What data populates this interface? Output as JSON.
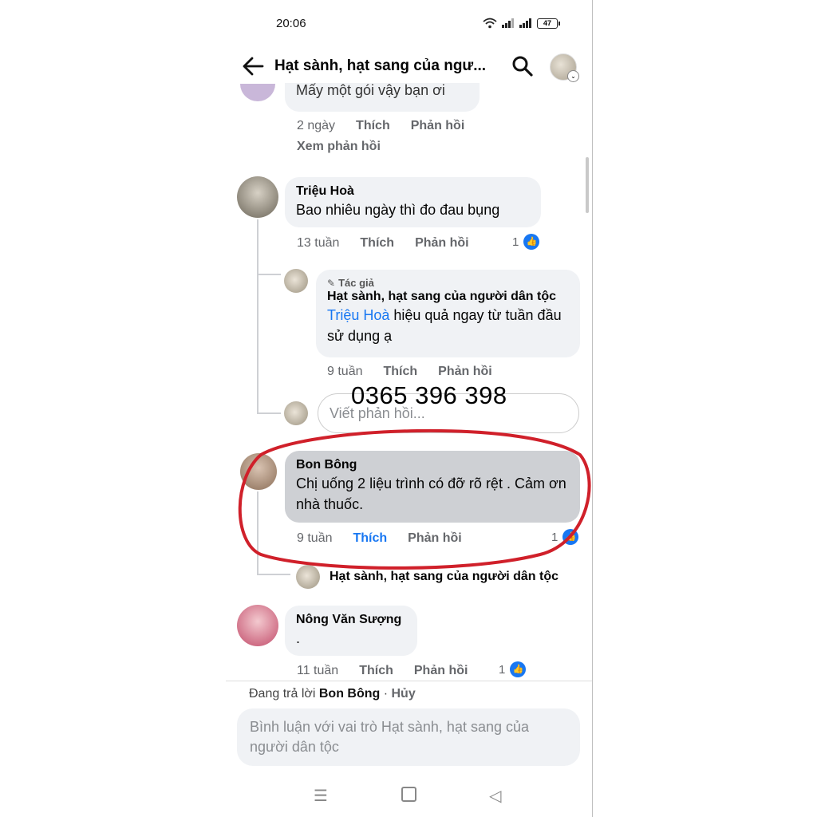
{
  "status": {
    "time": "20:06",
    "battery": "47"
  },
  "header": {
    "title": "Hạt sành, hạt sang của ngư...",
    "back_icon": "back-arrow-icon",
    "search_icon": "search-icon"
  },
  "comments": {
    "c0": {
      "text_partial": "Mấy một gói vậy bạn ơi",
      "time": "2 ngày",
      "like": "Thích",
      "reply": "Phản hồi",
      "view_replies": "Xem phản hồi"
    },
    "c1": {
      "name": "Triệu Hoà",
      "text": "Bao nhiêu ngày thì đo đau bụng",
      "time": "13 tuần",
      "like": "Thích",
      "reply": "Phản hồi",
      "reactions": "1"
    },
    "r1": {
      "badge": "Tác giả",
      "name": "Hạt sành, hạt sang của người dân tộc",
      "mention": "Triệu Hoà",
      "text": " hiệu quả ngay từ tuần đầu sử dụng ạ",
      "time": "9 tuần",
      "like": "Thích",
      "reply": "Phản hồi"
    },
    "reply_placeholder": "Viết phản hồi...",
    "c2": {
      "name": "Bon Bông",
      "text": "Chị uống 2 liệu trình có đỡ rõ rệt . Cảm ơn nhà thuốc.",
      "time": "9 tuần",
      "like": "Thích",
      "reply": "Phản hồi",
      "reactions": "1"
    },
    "c2_reply_author": "Hạt sành, hạt sang của người dân tộc",
    "c3": {
      "name": "Nông Văn Sượng",
      "text": ".",
      "time": "11 tuần",
      "like": "Thích",
      "reply": "Phản hồi",
      "reactions": "1"
    }
  },
  "overlay_phone": "0365 396 398",
  "replying": {
    "prefix": "Đang trả lời ",
    "name": "Bon Bông",
    "sep": " · ",
    "cancel": "Hủy"
  },
  "composer": {
    "placeholder": "Bình luận với vai trò Hạt sành, hạt sang của người dân tộc"
  },
  "colors": {
    "accent": "#1877f2",
    "highlight_ring": "#d0202a",
    "bubble": "#f0f2f5"
  }
}
